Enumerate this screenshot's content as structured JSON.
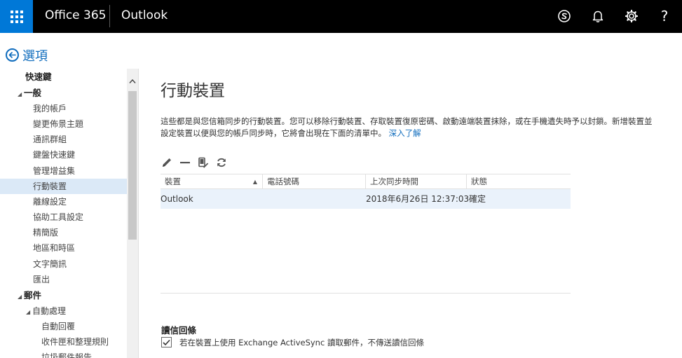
{
  "topbar": {
    "brand": "Office 365",
    "app": "Outlook",
    "help_label": "?",
    "icons": [
      "app-launcher-icon",
      "skype-icon",
      "bell-icon",
      "gear-icon",
      "help-icon"
    ],
    "background": "#000000",
    "launcher_color": "#0078d7"
  },
  "header": {
    "title": "選項"
  },
  "nav": {
    "items": [
      {
        "label": "快速鍵"
      },
      {
        "label": "一般"
      },
      {
        "label": "我的帳戶"
      },
      {
        "label": "變更佈景主題"
      },
      {
        "label": "通訊群組"
      },
      {
        "label": "鍵盤快速鍵"
      },
      {
        "label": "管理增益集"
      },
      {
        "label": "行動裝置"
      },
      {
        "label": "離線設定"
      },
      {
        "label": "協助工具設定"
      },
      {
        "label": "精簡版"
      },
      {
        "label": "地區和時區"
      },
      {
        "label": "文字簡訊"
      },
      {
        "label": "匯出"
      },
      {
        "label": "郵件"
      },
      {
        "label": "自動處理"
      },
      {
        "label": "自動回覆"
      },
      {
        "label": "收件匣和整理規則"
      },
      {
        "label": "垃圾郵件報告"
      }
    ],
    "selected": "行動裝置"
  },
  "main": {
    "title": "行動裝置",
    "description": "這些都是與您信箱同步的行動裝置。您可以移除行動裝置、存取裝置復原密碼、啟動遠端裝置抹除，或在手機遺失時予以封鎖。新增裝置並設定裝置以便與您的帳戶同步時，它將會出現在下面的清單中。",
    "learn_more": "深入了解",
    "toolbar_icons": [
      "edit-pencil-icon",
      "remove-minus-icon",
      "wipe-device-icon",
      "refresh-icon"
    ],
    "table": {
      "columns": [
        "裝置",
        "電話號碼",
        "上次同步時間",
        "狀態"
      ],
      "rows": [
        {
          "device": "Outlook",
          "phone": "",
          "last_sync": "2018年6月26日 12:37:03",
          "status": "確定"
        }
      ]
    }
  },
  "read_receipts": {
    "title": "讀信回條",
    "option_label": "若在裝置上使用 Exchange ActiveSync 讀取郵件，不傳送讀信回條",
    "checked": true
  },
  "colors": {
    "accent": "#0f6cbd",
    "selected_nav": "#dbe9f7",
    "selected_row": "#eaf2fb"
  }
}
